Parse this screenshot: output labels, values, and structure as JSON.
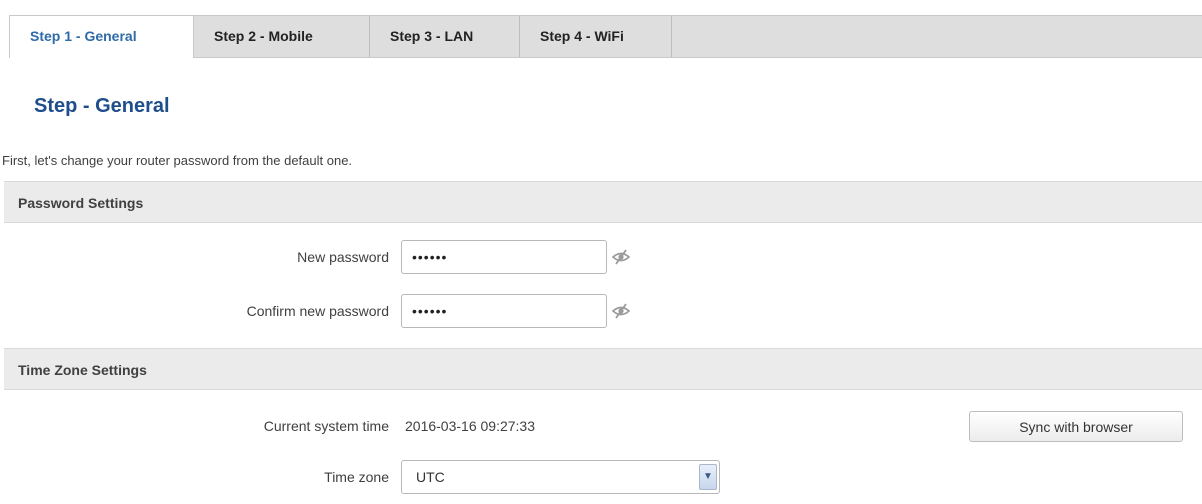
{
  "tabs": [
    {
      "label": "Step 1 - General",
      "active": true
    },
    {
      "label": "Step 2 - Mobile",
      "active": false
    },
    {
      "label": "Step 3 - LAN",
      "active": false
    },
    {
      "label": "Step 4 - WiFi",
      "active": false
    }
  ],
  "page": {
    "title": "Step - General",
    "intro": "First, let's change your router password from the default one."
  },
  "password_settings": {
    "header": "Password Settings",
    "new_password": {
      "label": "New password",
      "value": "passwd",
      "icon": "eye-slash-icon"
    },
    "confirm_password": {
      "label": "Confirm new password",
      "value": "passwd",
      "icon": "eye-slash-icon"
    }
  },
  "time_zone_settings": {
    "header": "Time Zone Settings",
    "current_time": {
      "label": "Current system time",
      "value": "2016-03-16 09:27:33"
    },
    "sync_button": "Sync with browser",
    "time_zone": {
      "label": "Time zone",
      "selected": "UTC",
      "icon": "chevron-down-icon"
    }
  },
  "colors": {
    "accent": "#1f4e8c",
    "active_tab_text": "#2e6ba8",
    "tabbar_bg": "#dedede",
    "section_bg": "#ebebeb"
  }
}
